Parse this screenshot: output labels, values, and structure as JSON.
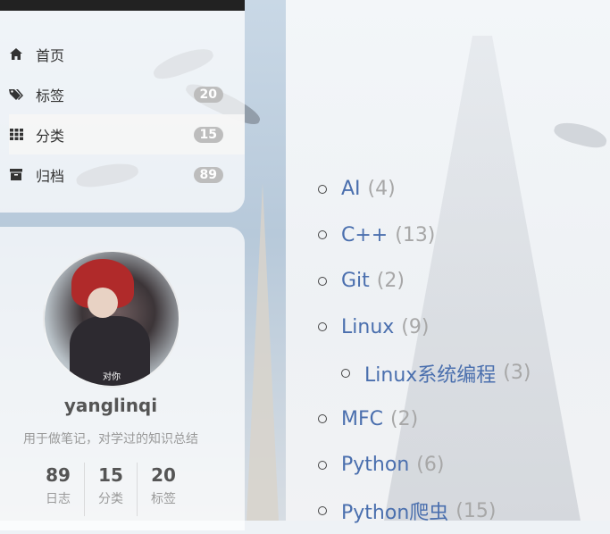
{
  "sidebar": {
    "menu": [
      {
        "label": "首页",
        "icon": "home-icon",
        "badge": null
      },
      {
        "label": "标签",
        "icon": "tags-icon",
        "badge": "20"
      },
      {
        "label": "分类",
        "icon": "grid-icon",
        "badge": "15"
      },
      {
        "label": "归档",
        "icon": "archive-icon",
        "badge": "89"
      }
    ],
    "profile": {
      "avatar_caption": "对你",
      "name": "yanglinqi",
      "description": "用于做笔记，对学过的知识总结",
      "stats": [
        {
          "count": "89",
          "label": "日志"
        },
        {
          "count": "15",
          "label": "分类"
        },
        {
          "count": "20",
          "label": "标签"
        }
      ]
    }
  },
  "categories": [
    {
      "name": "AI",
      "count": "(4)"
    },
    {
      "name": "C++",
      "count": "(13)"
    },
    {
      "name": "Git",
      "count": "(2)"
    },
    {
      "name": "Linux",
      "count": "(9)"
    },
    {
      "name": "Linux系统编程",
      "count": "(3)"
    },
    {
      "name": "MFC",
      "count": "(2)"
    },
    {
      "name": "Python",
      "count": "(6)"
    },
    {
      "name": "Python爬虫",
      "count": "(15)"
    }
  ],
  "colors": {
    "link": "#4a6fae",
    "count": "#a7a7a7",
    "badge": "#bdbdbd"
  }
}
